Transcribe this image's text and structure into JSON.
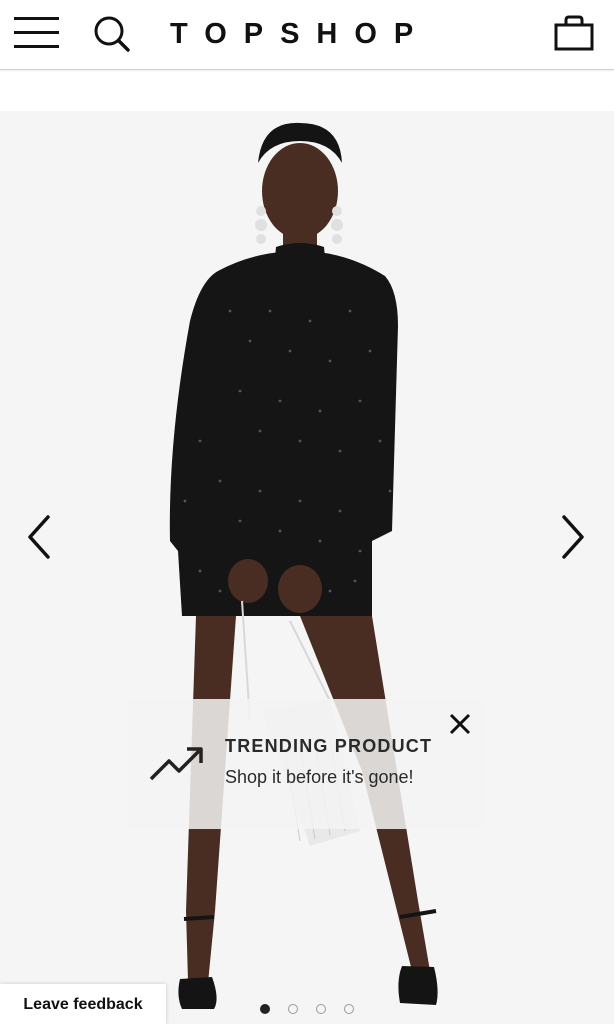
{
  "header": {
    "brand": "TOPSHOP",
    "icons": {
      "menu": "hamburger-menu-icon",
      "search": "search-icon",
      "bag": "shopping-bag-icon"
    }
  },
  "gallery": {
    "image_description_icon": "product-photo",
    "prev_icon": "chevron-left-icon",
    "next_icon": "chevron-right-icon",
    "page_count": 4,
    "active_page": 1
  },
  "toast": {
    "title": "TRENDING PRODUCT",
    "subtitle": "Shop it before it's gone!",
    "icon": "trending-up-icon",
    "close_icon": "close-icon"
  },
  "feedback": {
    "label": "Leave feedback"
  },
  "colors": {
    "text": "#111111",
    "gallery_bg": "#f5f5f6",
    "toast_bg": "#f3f3f3",
    "dot_active": "#222222",
    "dot_inactive": "#9a9a9a"
  }
}
